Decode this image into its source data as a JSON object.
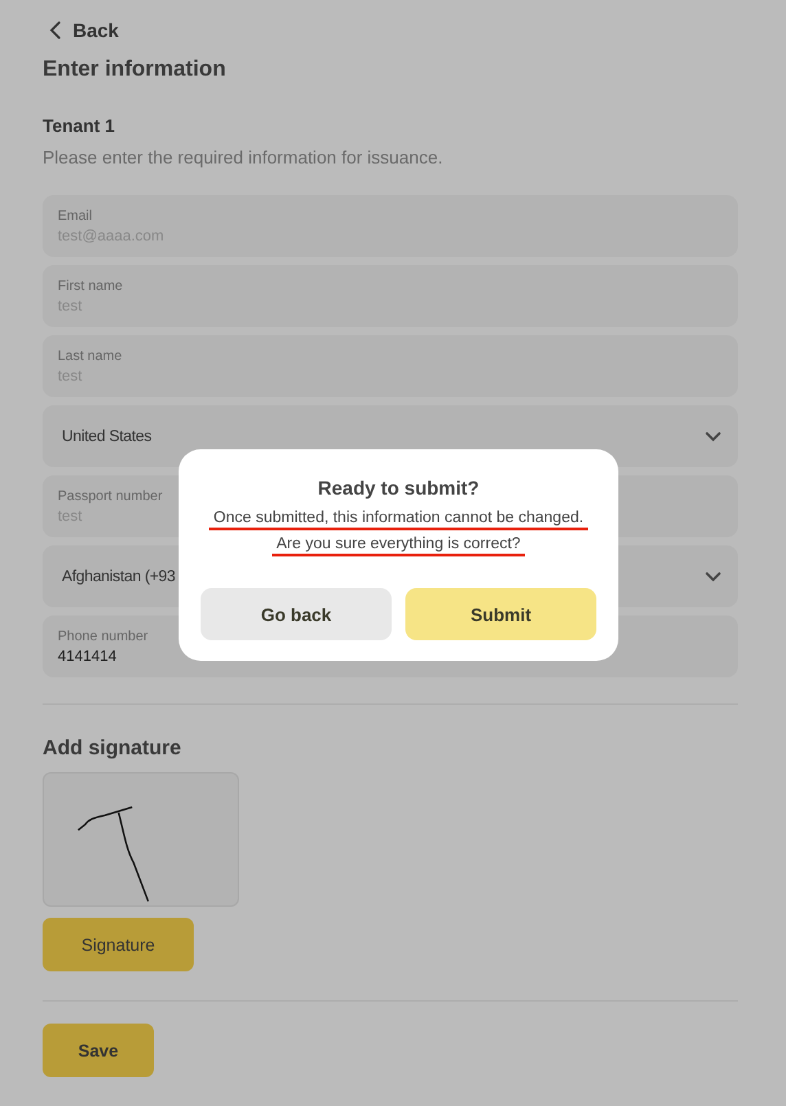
{
  "back": {
    "label": "Back"
  },
  "title": "Enter information",
  "section": {
    "title": "Tenant 1",
    "hint": "Please enter the required information for issuance."
  },
  "fields": [
    {
      "kind": "text",
      "label": "Email",
      "placeholder": "test@aaaa.com"
    },
    {
      "kind": "text",
      "label": "First name",
      "placeholder": "test"
    },
    {
      "kind": "text",
      "label": "Last name",
      "placeholder": "test"
    },
    {
      "kind": "select",
      "value": "United States"
    },
    {
      "kind": "text",
      "label": "Passport number",
      "placeholder": "test"
    },
    {
      "kind": "select",
      "value": "Afghanistan (+93"
    },
    {
      "kind": "text",
      "label": "Phone number",
      "value": "4141414"
    }
  ],
  "signature": {
    "title": "Add signature",
    "button": "Signature"
  },
  "save_button": "Save",
  "dialog": {
    "title": "Ready to submit?",
    "message_lines": [
      {
        "text": "Once submitted, this information cannot be changed.",
        "underlined": true
      },
      {
        "text": "Are you sure everything is correct?",
        "underlined": true
      }
    ],
    "buttons": [
      {
        "label": "Go back",
        "kind": "secondary"
      },
      {
        "label": "Submit",
        "kind": "primary"
      }
    ]
  }
}
